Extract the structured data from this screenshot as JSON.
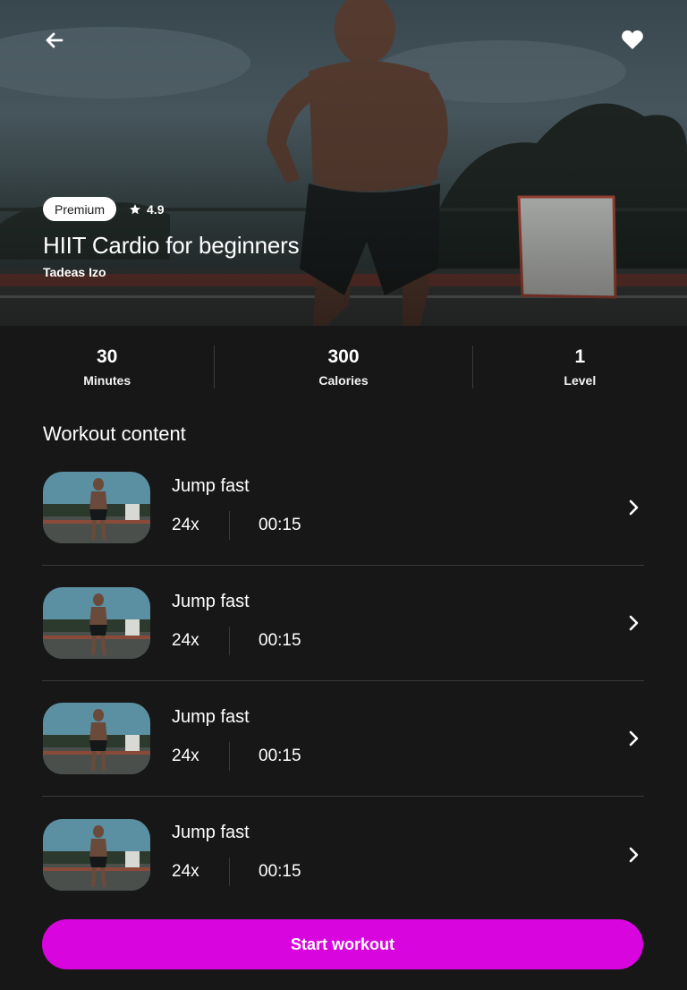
{
  "header": {
    "back_icon": "arrow-left-icon",
    "favorite_icon": "heart-icon",
    "badge": "Premium",
    "rating_icon": "star-icon",
    "rating": "4.9",
    "title": "HIIT Cardio for beginners",
    "author": "Tadeas Izo"
  },
  "stats": [
    {
      "value": "30",
      "label": "Minutes"
    },
    {
      "value": "300",
      "label": "Calories"
    },
    {
      "value": "1",
      "label": "Level"
    }
  ],
  "section_title": "Workout content",
  "exercises": [
    {
      "name": "Jump fast",
      "reps": "24x",
      "duration": "00:15"
    },
    {
      "name": "Jump fast",
      "reps": "24x",
      "duration": "00:15"
    },
    {
      "name": "Jump fast",
      "reps": "24x",
      "duration": "00:15"
    },
    {
      "name": "Jump fast",
      "reps": "24x",
      "duration": "00:15"
    }
  ],
  "start_button": "Start workout",
  "colors": {
    "accent": "#d905df",
    "background": "#171717"
  }
}
